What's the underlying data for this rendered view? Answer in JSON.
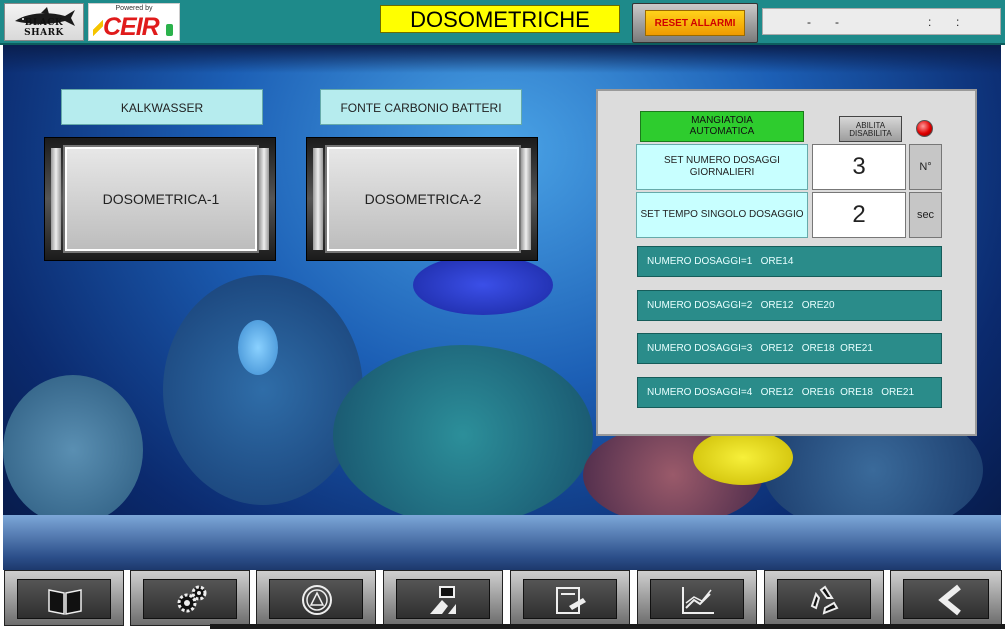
{
  "header": {
    "logo_left_text": "BLACK SHARK",
    "logo_right_powered": "Powered by",
    "logo_right_brand": "CEIR",
    "title": "DOSOMETRICHE",
    "reset_label": "RESET ALLARMI",
    "datetime": {
      "sep1": "-",
      "sep2": "-",
      "sep3": ":",
      "sep4": ":"
    }
  },
  "main": {
    "label_left": "KALKWASSER",
    "label_right": "FONTE CARBONIO BATTERI",
    "dos1": "DOSOMETRICA-1",
    "dos2": "DOSOMETRICA-2"
  },
  "panel": {
    "mangiatoia_line1": "MANGIATOIA",
    "mangiatoia_line2": "AUTOMATICA",
    "abilita_line1": "ABILITA",
    "abilita_line2": "DISABILITA",
    "led_state": "red",
    "set_num_label": "SET NUMERO DOSAGGI GIORNALIERI",
    "set_num_value": "3",
    "set_num_unit": "N°",
    "set_time_label": "SET TEMPO SINGOLO DOSAGGIO",
    "set_time_value": "2",
    "set_time_unit": "sec",
    "rows": [
      "NUMERO DOSAGGI=1   ORE14",
      "NUMERO DOSAGGI=2   ORE12   ORE20",
      "NUMERO DOSAGGI=3   ORE12   ORE18  ORE21",
      "NUMERO DOSAGGI=4   ORE12   ORE16  ORE18   ORE21"
    ]
  },
  "nav": {
    "icons": [
      "book-icon",
      "gears-icon",
      "alarm-warning-icon",
      "hmi-panel-icon",
      "document-edit-icon",
      "trend-chart-icon",
      "recycle-icon",
      "back-arrow-icon"
    ]
  },
  "colors": {
    "header": "#1e8a8a",
    "title_bg": "#ffff00",
    "label_bg": "#b6ecee",
    "mangiatoia": "#2ecc2e",
    "row_bg": "#2a8c8a"
  }
}
